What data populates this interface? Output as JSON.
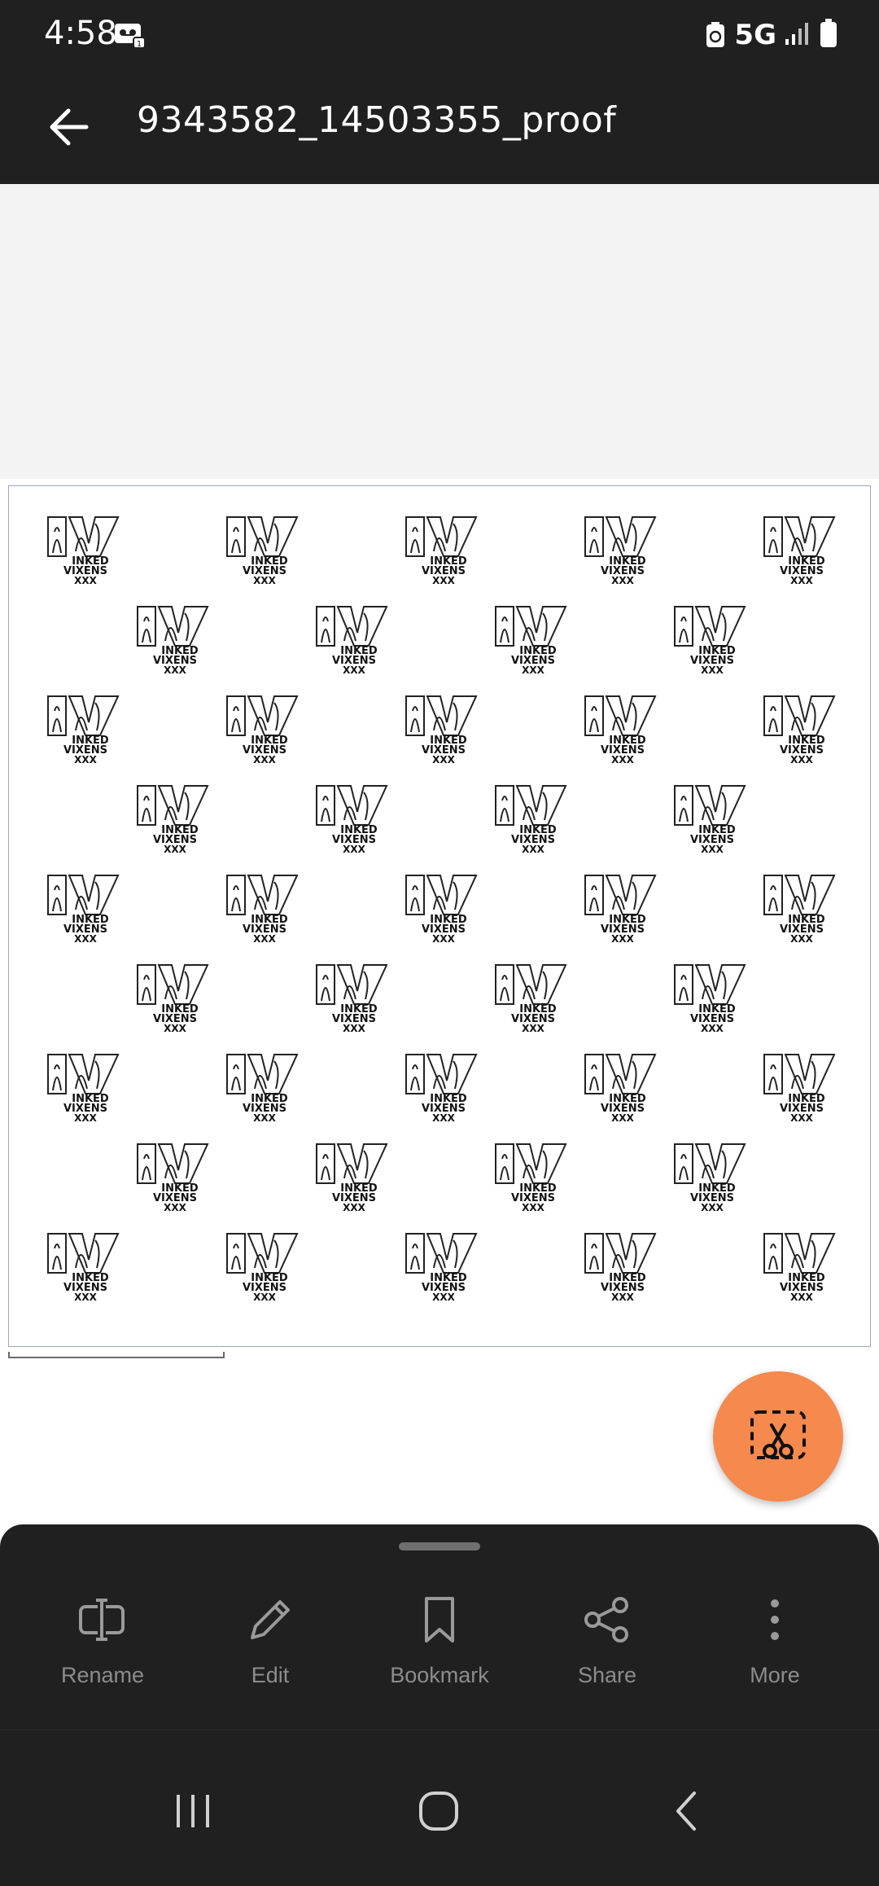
{
  "status_bar": {
    "time": "4:58",
    "network": "5G",
    "icons": [
      "voicemail-icon",
      "recycle-icon",
      "signal-icon",
      "battery-icon"
    ]
  },
  "app_bar": {
    "title": "9343582_14503355_proof",
    "back_icon": "arrow-left-icon"
  },
  "document": {
    "logo_lines": [
      "INKED",
      "VIXENS",
      "XXX"
    ]
  },
  "fab": {
    "icon": "scissors-crop-icon"
  },
  "actions": [
    {
      "label": "Rename",
      "icon": "rename-icon"
    },
    {
      "label": "Edit",
      "icon": "pencil-icon"
    },
    {
      "label": "Bookmark",
      "icon": "bookmark-icon"
    },
    {
      "label": "Share",
      "icon": "share-icon"
    },
    {
      "label": "More",
      "icon": "more-vertical-icon"
    }
  ],
  "nav_bar": {
    "icons": [
      "recents-icon",
      "home-icon",
      "back-icon"
    ]
  },
  "colors": {
    "bar_background": "#202020",
    "viewer_background": "#f3f3f3",
    "fab_accent": "#f5894e",
    "label_gray": "#8c8c8c"
  }
}
